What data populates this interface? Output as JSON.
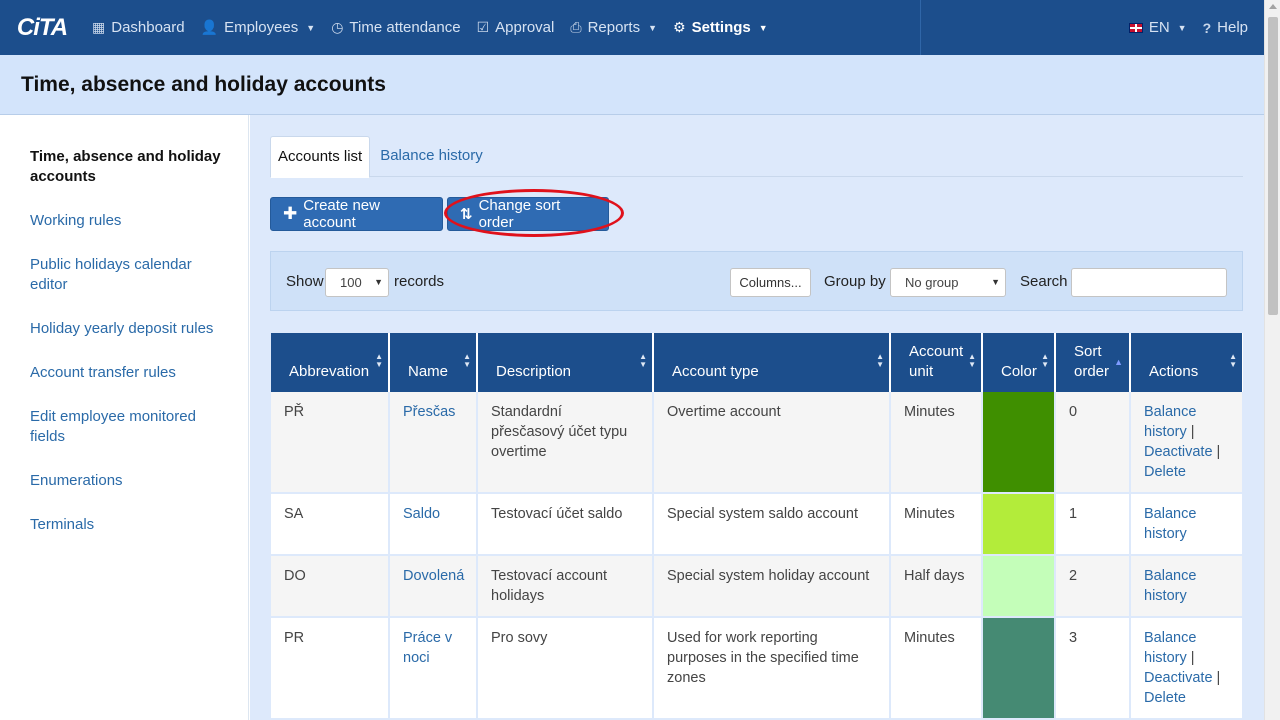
{
  "nav": {
    "logo": "CiTA",
    "items": [
      {
        "label": "Dashboard",
        "icon": "grid-icon"
      },
      {
        "label": "Employees",
        "icon": "user-icon",
        "dropdown": true
      },
      {
        "label": "Time attendance",
        "icon": "clock-icon"
      },
      {
        "label": "Approval",
        "icon": "check-square-icon"
      },
      {
        "label": "Reports",
        "icon": "printer-icon",
        "dropdown": true
      },
      {
        "label": "Settings",
        "icon": "gear-icon",
        "dropdown": true,
        "active": true
      }
    ],
    "language": "EN",
    "help": "Help"
  },
  "page": {
    "title": "Time, absence and holiday accounts"
  },
  "sidebar": {
    "items": [
      {
        "label": "Time, absence and holiday accounts",
        "active": true
      },
      {
        "label": "Working rules"
      },
      {
        "label": "Public holidays calendar editor"
      },
      {
        "label": "Holiday yearly deposit rules"
      },
      {
        "label": "Account transfer rules"
      },
      {
        "label": "Edit employee monitored fields"
      },
      {
        "label": "Enumerations"
      },
      {
        "label": "Terminals"
      }
    ]
  },
  "tabs": [
    {
      "label": "Accounts list",
      "active": true
    },
    {
      "label": "Balance history"
    }
  ],
  "toolbar": {
    "create_label": "Create new account",
    "sort_label": "Change sort order"
  },
  "filters": {
    "show_label": "Show",
    "show_value": "100",
    "records_label": "records",
    "columns_label": "Columns...",
    "group_by_label": "Group by",
    "group_by_value": "No group",
    "search_label": "Search",
    "search_value": ""
  },
  "table": {
    "columns": [
      "Abbrevation",
      "Name",
      "Description",
      "Account type",
      "Account unit",
      "Color",
      "Sort order",
      "Actions"
    ],
    "rows": [
      {
        "abbr": "PŘ",
        "name": "Přesčas",
        "description": "Standardní přesčasový účet typu overtime",
        "type": "Overtime account",
        "unit": "Minutes",
        "color": "#3f8f00",
        "sort": "0",
        "actions": [
          "Balance history",
          "Deactivate",
          "Delete"
        ]
      },
      {
        "abbr": "SA",
        "name": "Saldo",
        "description": "Testovací účet saldo",
        "type": "Special system saldo account",
        "unit": "Minutes",
        "color": "#b3ec3a",
        "sort": "1",
        "actions": [
          "Balance history"
        ]
      },
      {
        "abbr": "DO",
        "name": "Dovolená",
        "description": "Testovací account holidays",
        "type": "Special system holiday account",
        "unit": "Half days",
        "color": "#c4feb9",
        "sort": "2",
        "actions": [
          "Balance history"
        ]
      },
      {
        "abbr": "PR",
        "name": "Práce v noci",
        "description": "Pro sovy",
        "type": "Used for work reporting purposes in the specified time zones",
        "unit": "Minutes",
        "color": "#458a73",
        "sort": "3",
        "actions": [
          "Balance history",
          "Deactivate",
          "Delete"
        ]
      },
      {
        "abbr": "",
        "name": "",
        "description": "",
        "type": "",
        "unit": "",
        "color": "#cfc97a",
        "sort": "",
        "actions": []
      }
    ]
  },
  "colors": {
    "navbar": "#1c4e8c",
    "accent": "#2f6bb3",
    "highlight": "#e0111b"
  }
}
